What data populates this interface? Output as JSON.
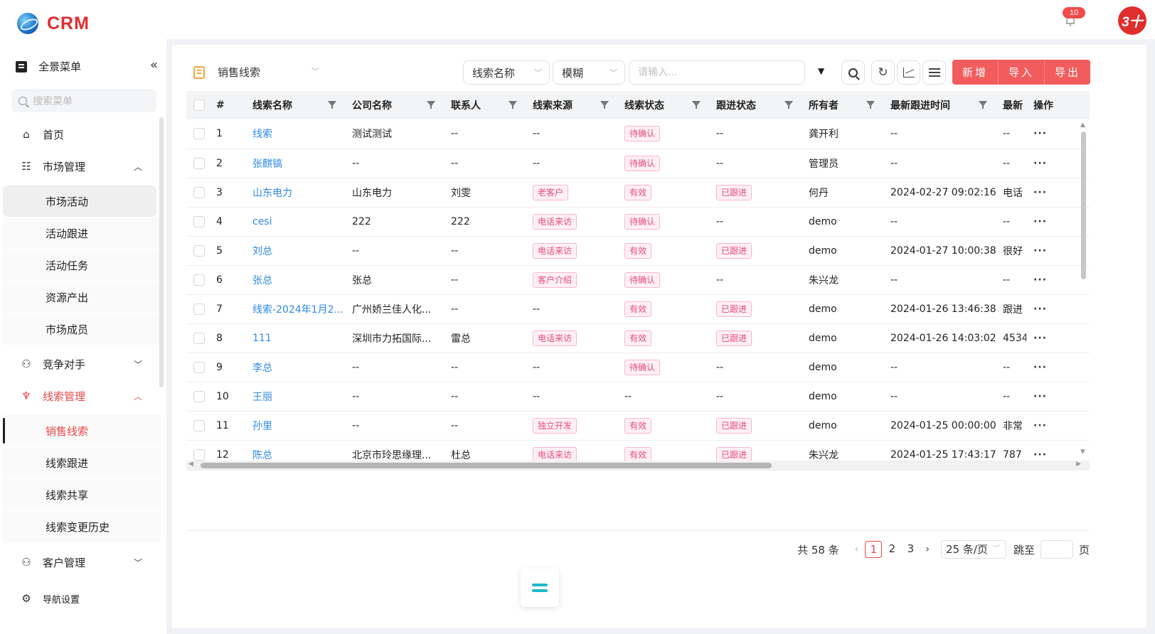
{
  "app": {
    "brand": "CRM",
    "notification_count": "10",
    "avatar_text": "3十"
  },
  "sidebar": {
    "header_label": "全景菜单",
    "search_placeholder": "搜索菜单",
    "items": {
      "home": "首页",
      "market": "市场管理",
      "market_activity": "市场活动",
      "activity_follow": "活动跟进",
      "activity_task": "活动任务",
      "resource_output": "资源产出",
      "market_member": "市场成员",
      "competitor": "竞争对手",
      "lead_mgmt": "线索管理",
      "sales_lead": "销售线索",
      "lead_follow": "线索跟进",
      "lead_share": "线索共享",
      "lead_history": "线索变更历史",
      "customer": "客户管理",
      "nav_settings": "导航设置"
    }
  },
  "toolbar": {
    "view_name": "销售线索",
    "field_select": "线索名称",
    "match_select": "模糊",
    "search_placeholder": "请输入...",
    "add_label": "新增",
    "import_label": "导入",
    "export_label": "导出"
  },
  "table": {
    "columns": [
      "#",
      "线索名称",
      "公司名称",
      "联系人",
      "线索来源",
      "线索状态",
      "跟进状态",
      "所有者",
      "最新跟进时间",
      "最新",
      "操作"
    ],
    "rows": [
      {
        "no": "1",
        "name": "线索",
        "company": "测试测试",
        "contact": "--",
        "source": "--",
        "status": "待确认",
        "follow": "--",
        "owner": "龚开利",
        "time": "--",
        "latest": "--"
      },
      {
        "no": "2",
        "name": "张麒镐",
        "company": "--",
        "contact": "--",
        "source": "--",
        "status": "待确认",
        "follow": "--",
        "owner": "管理员",
        "time": "--",
        "latest": "--"
      },
      {
        "no": "3",
        "name": "山东电力",
        "company": "山东电力",
        "contact": "刘雯",
        "source": "老客户",
        "status": "有效",
        "follow": "已跟进",
        "owner": "何丹",
        "time": "2024-02-27 09:02:16",
        "latest": "电话"
      },
      {
        "no": "4",
        "name": "cesi",
        "company": "222",
        "contact": "222",
        "source": "电话来访",
        "status": "待确认",
        "follow": "--",
        "owner": "demo",
        "time": "--",
        "latest": "--"
      },
      {
        "no": "5",
        "name": "刘总",
        "company": "--",
        "contact": "--",
        "source": "电话来访",
        "status": "有效",
        "follow": "已跟进",
        "owner": "demo",
        "time": "2024-01-27 10:00:38",
        "latest": "很好"
      },
      {
        "no": "6",
        "name": "张总",
        "company": "张总",
        "contact": "--",
        "source": "客户介绍",
        "status": "待确认",
        "follow": "--",
        "owner": "朱兴龙",
        "time": "--",
        "latest": "--"
      },
      {
        "no": "7",
        "name": "线索-2024年1月2...",
        "company": "广州娇兰佳人化...",
        "contact": "--",
        "source": "--",
        "status": "有效",
        "follow": "已跟进",
        "owner": "demo",
        "time": "2024-01-26 13:46:38",
        "latest": "跟进"
      },
      {
        "no": "8",
        "name": "111",
        "company": "深圳市力拓国际...",
        "contact": "雷总",
        "source": "电话来访",
        "status": "有效",
        "follow": "已跟进",
        "owner": "demo",
        "time": "2024-01-26 14:03:02",
        "latest": "4534"
      },
      {
        "no": "9",
        "name": "李总",
        "company": "--",
        "contact": "--",
        "source": "--",
        "status": "待确认",
        "follow": "--",
        "owner": "demo",
        "time": "--",
        "latest": "--"
      },
      {
        "no": "10",
        "name": "王丽",
        "company": "--",
        "contact": "--",
        "source": "--",
        "status": "--",
        "follow": "--",
        "owner": "demo",
        "time": "--",
        "latest": "--"
      },
      {
        "no": "11",
        "name": "孙里",
        "company": "--",
        "contact": "--",
        "source": "独立开发",
        "status": "有效",
        "follow": "已跟进",
        "owner": "demo",
        "time": "2024-01-25 00:00:00",
        "latest": "非常"
      },
      {
        "no": "12",
        "name": "陈总",
        "company": "北京市玲思缘理...",
        "contact": "杜总",
        "source": "电话来访",
        "status": "有效",
        "follow": "已跟进",
        "owner": "朱兴龙",
        "time": "2024-01-25 17:43:17",
        "latest": "787"
      }
    ],
    "more_icon": "···"
  },
  "pagination": {
    "total": "共 58 条",
    "pages": [
      "1",
      "2",
      "3"
    ],
    "current": "1",
    "page_size": "25 条/页",
    "jump_label": "跳至",
    "page_suffix": "页"
  },
  "colors": {
    "accent": "#e84848",
    "link": "#2f8ae8",
    "action_bg": "#f25c5c",
    "tag": "#e84b7a"
  }
}
